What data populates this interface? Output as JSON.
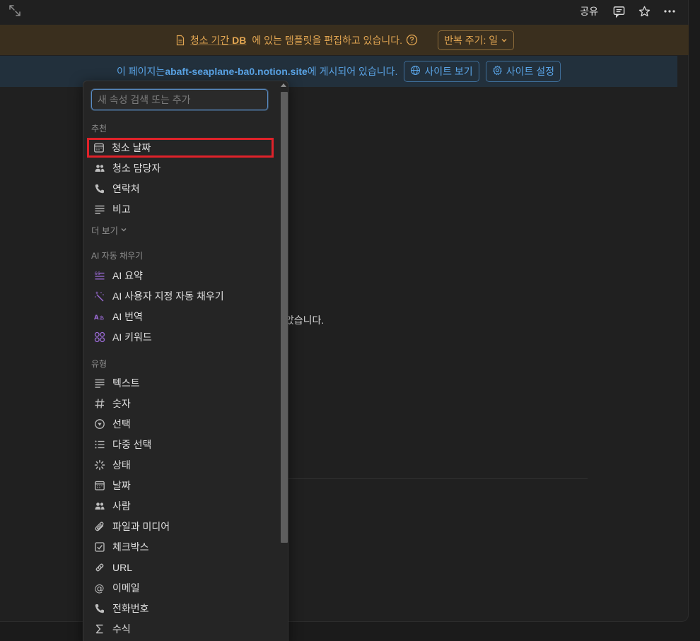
{
  "topbar": {
    "share_label": "공유",
    "icons": [
      "expand-icon",
      "comment-icon",
      "star-icon",
      "more-icon"
    ]
  },
  "template_banner": {
    "db_name": "청소 기간",
    "db_suffix": "DB",
    "text": "에 있는 템플릿을 편집하고 있습니다.",
    "repeat_label": "반복 주기: 일"
  },
  "site_banner": {
    "prefix": "이 페이지는 ",
    "url": "abaft-seaplane-ba0.notion.site",
    "suffix": "에 게시되어 있습니다.",
    "view_site": "사이트 보기",
    "site_settings": "사이트 설정"
  },
  "background": {
    "partial_text": "않았습니다."
  },
  "dropdown": {
    "search_placeholder": "새 속성 검색 또는 추가",
    "sections": {
      "recommended": "추천",
      "ai_autofill": "AI 자동 채우기",
      "types": "유형"
    },
    "recommended": [
      {
        "label": "청소 날짜",
        "icon": "calendar-icon"
      },
      {
        "label": "청소 담당자",
        "icon": "people-icon"
      },
      {
        "label": "연락처",
        "icon": "phone-icon"
      },
      {
        "label": "비고",
        "icon": "text-lines-icon"
      }
    ],
    "more_label": "더 보기",
    "ai": [
      {
        "label": "AI 요약",
        "icon": "ai-summary-icon"
      },
      {
        "label": "AI 사용자 지정 자동 채우기",
        "icon": "sparkle-icon"
      },
      {
        "label": "AI 번역",
        "icon": "translate-icon"
      },
      {
        "label": "AI 키워드",
        "icon": "keywords-icon"
      }
    ],
    "types": [
      {
        "label": "텍스트",
        "icon": "text-lines-icon"
      },
      {
        "label": "숫자",
        "icon": "hash-icon"
      },
      {
        "label": "선택",
        "icon": "select-icon"
      },
      {
        "label": "다중 선택",
        "icon": "list-icon"
      },
      {
        "label": "상태",
        "icon": "status-icon"
      },
      {
        "label": "날짜",
        "icon": "calendar-icon"
      },
      {
        "label": "사람",
        "icon": "people-icon"
      },
      {
        "label": "파일과 미디어",
        "icon": "paperclip-icon"
      },
      {
        "label": "체크박스",
        "icon": "checkbox-icon"
      },
      {
        "label": "URL",
        "icon": "link-icon"
      },
      {
        "label": "이메일",
        "icon": "at-icon"
      },
      {
        "label": "전화번호",
        "icon": "phone-icon"
      },
      {
        "label": "수식",
        "icon": "sigma-icon"
      }
    ]
  },
  "colors": {
    "template_banner_bg": "#3a2f1e",
    "template_banner_text": "#e2a652",
    "site_banner_bg": "#22303c",
    "site_banner_text": "#5aa4e6",
    "highlight": "#e0222a",
    "ai_purple": "#9b6bd6"
  }
}
